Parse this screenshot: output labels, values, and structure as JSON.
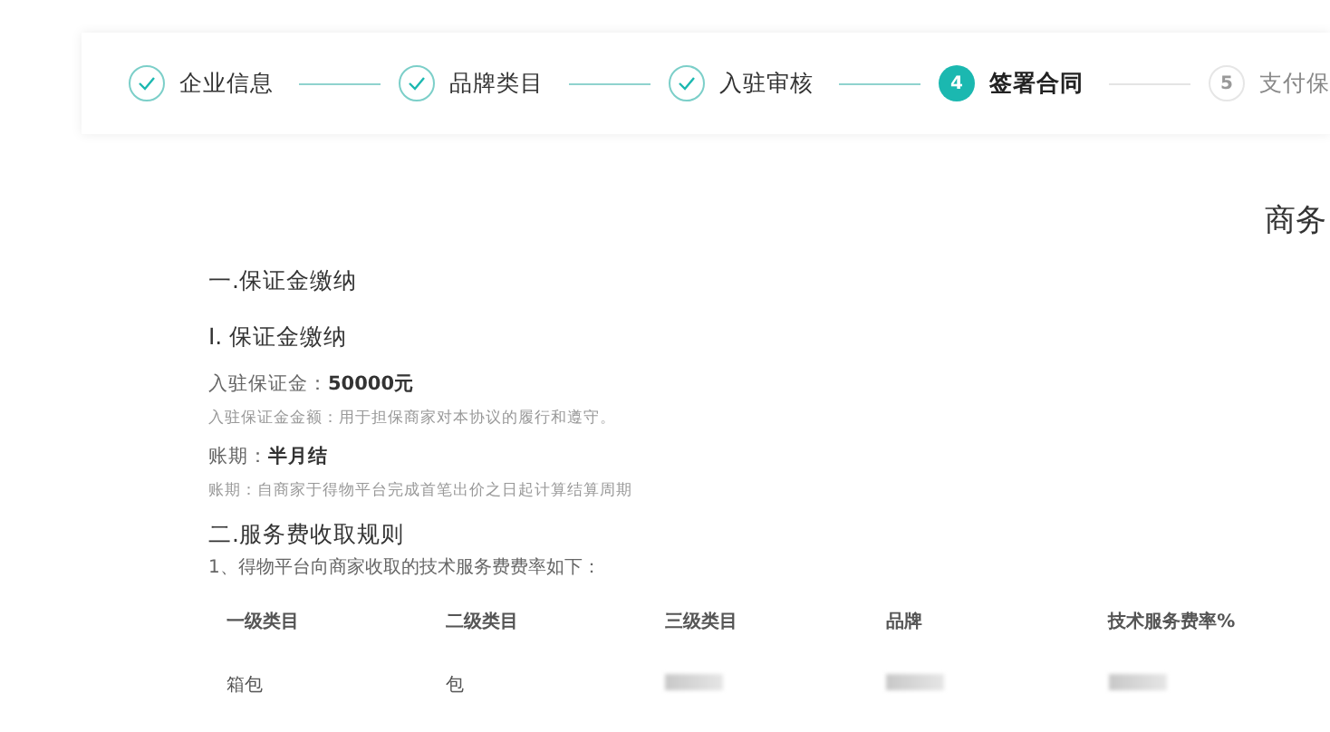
{
  "steps": [
    {
      "label": "企业信息",
      "kind": "done"
    },
    {
      "label": "品牌类目",
      "kind": "done"
    },
    {
      "label": "入驻审核",
      "kind": "done"
    },
    {
      "number": "4",
      "label": "签署合同",
      "kind": "active"
    },
    {
      "number": "5",
      "label": "支付保",
      "kind": "pending"
    }
  ],
  "page_title": "商务",
  "sections": [
    {
      "kind": "heading",
      "text": "一.保证金缴纳"
    },
    {
      "kind": "subheading",
      "text": "I. 保证金缴纳"
    },
    {
      "kind": "field",
      "label": "入驻保证金：",
      "value": "50000元"
    },
    {
      "kind": "note",
      "text": "入驻保证金金额：用于担保商家对本协议的履行和遵守。"
    },
    {
      "kind": "field",
      "label": "账期：",
      "value": "半月结"
    },
    {
      "kind": "note",
      "text": "账期：自商家于得物平台完成首笔出价之日起计算结算周期"
    },
    {
      "kind": "heading2",
      "text": "二.服务费收取规则"
    },
    {
      "kind": "para",
      "text": "1、得物平台向商家收取的技术服务费费率如下："
    }
  ],
  "table": {
    "columns": [
      "一级类目",
      "二级类目",
      "三级类目",
      "品牌",
      "技术服务费率%"
    ],
    "rows": [
      [
        {
          "kind": "text",
          "text": "箱包"
        },
        {
          "kind": "text",
          "text": "包"
        },
        {
          "kind": "redacted"
        },
        {
          "kind": "redacted"
        },
        {
          "kind": "redacted"
        }
      ]
    ]
  }
}
